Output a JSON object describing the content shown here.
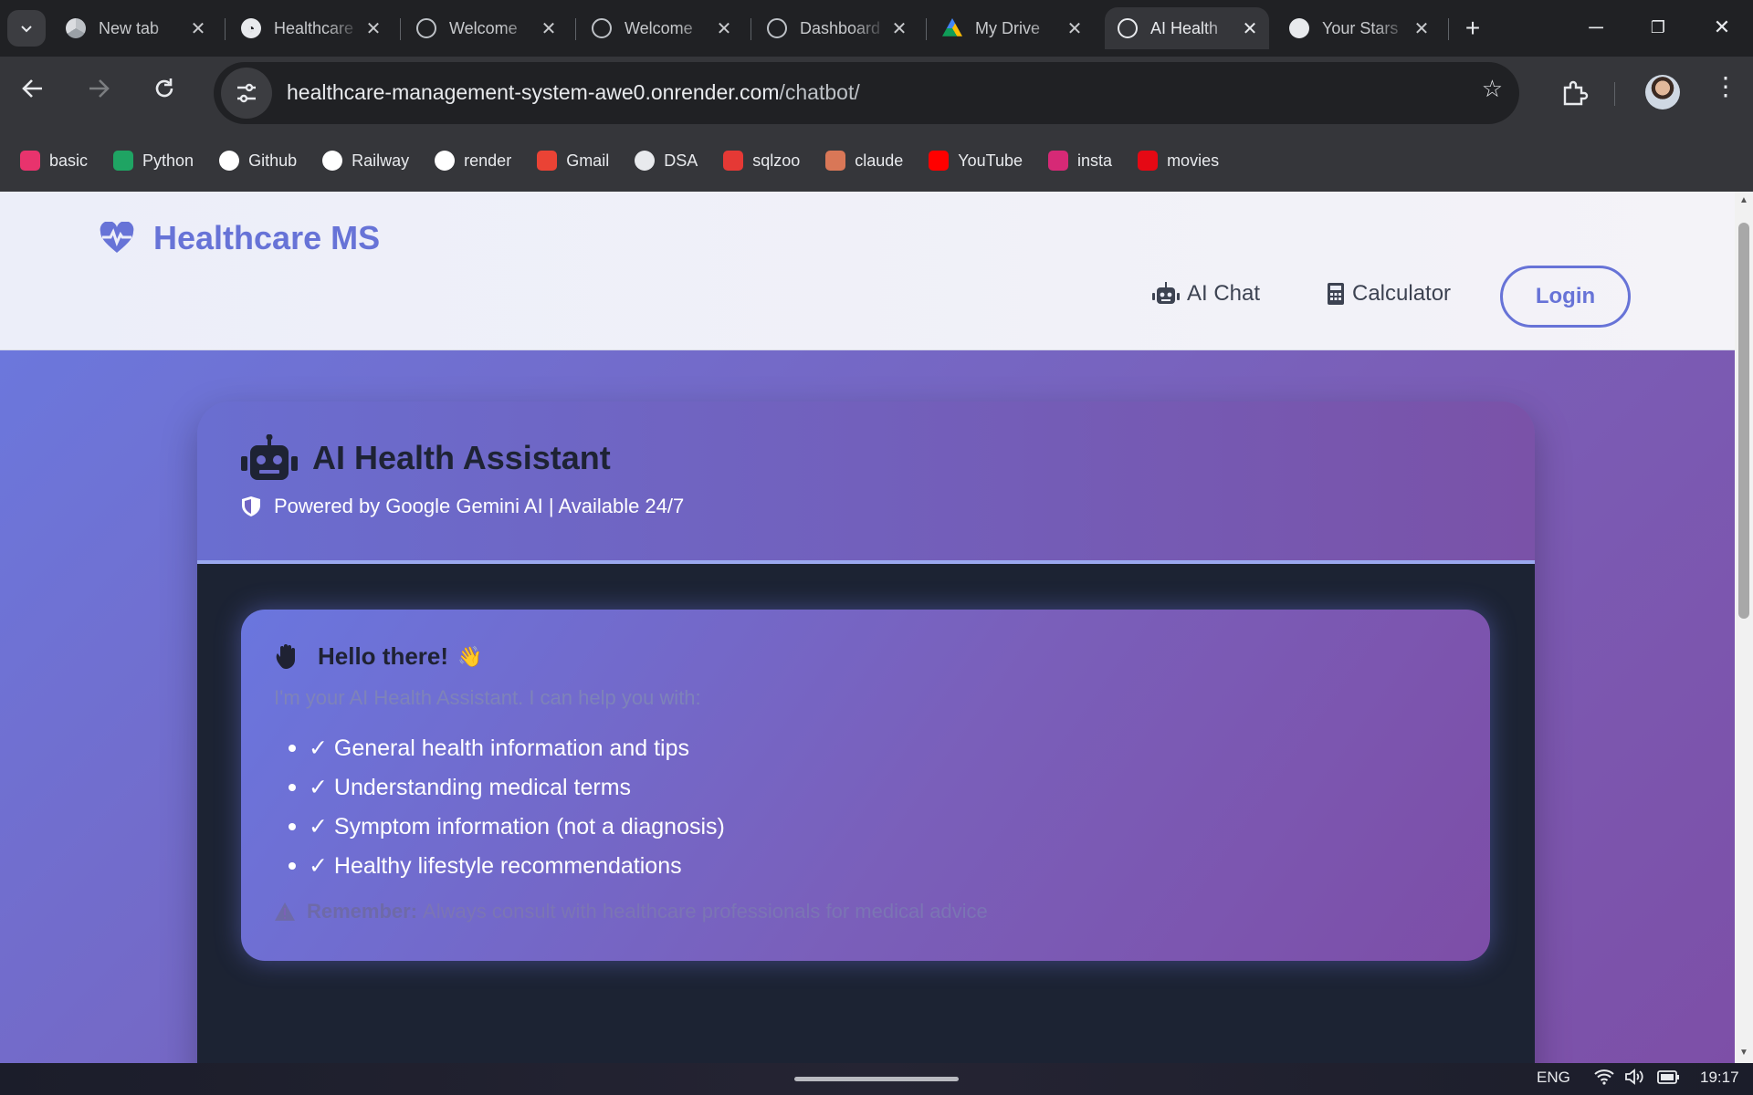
{
  "browser": {
    "tabs": [
      {
        "title": "New tab",
        "icon": "chrome-icon",
        "active": false
      },
      {
        "title": "Healthcare",
        "icon": "render-icon",
        "active": false
      },
      {
        "title": "Welcome",
        "icon": "globe-icon",
        "active": false
      },
      {
        "title": "Welcome",
        "icon": "globe-icon",
        "active": false
      },
      {
        "title": "Dashboard",
        "icon": "globe-icon",
        "active": false
      },
      {
        "title": "My Drive",
        "icon": "google-drive-icon",
        "active": false
      },
      {
        "title": "AI Health",
        "icon": "globe-icon",
        "active": true
      },
      {
        "title": "Your Stars",
        "icon": "github-icon",
        "active": false
      }
    ],
    "url_host": "healthcare-management-system-awe0.onrender.com",
    "url_path": "/chatbot/",
    "bookmarks": [
      {
        "label": "basic",
        "icon": "basic-icon",
        "color": "#e8336d"
      },
      {
        "label": "Python",
        "icon": "python-icon",
        "color": "#1fa463"
      },
      {
        "label": "Github",
        "icon": "github-icon",
        "color": "#ffffff"
      },
      {
        "label": "Railway",
        "icon": "railway-icon",
        "color": "#ffffff"
      },
      {
        "label": "render",
        "icon": "render-icon",
        "color": "#ffffff"
      },
      {
        "label": "Gmail",
        "icon": "gmail-icon",
        "color": "#ea4335"
      },
      {
        "label": "DSA",
        "icon": "rocket-icon",
        "color": "#e8eaed"
      },
      {
        "label": "sqlzoo",
        "icon": "sqlzoo-icon",
        "color": "#e53935"
      },
      {
        "label": "claude",
        "icon": "claude-icon",
        "color": "#d97757"
      },
      {
        "label": "YouTube",
        "icon": "youtube-icon",
        "color": "#ff0000"
      },
      {
        "label": "insta",
        "icon": "instagram-icon",
        "color": "#d62976"
      },
      {
        "label": "movies",
        "icon": "netflix-icon",
        "color": "#e50914"
      }
    ]
  },
  "site": {
    "brand": "Healthcare MS",
    "nav": {
      "ai_chat": "AI Chat",
      "calculator": "Calculator",
      "login": "Login"
    },
    "accent": "#6773d7"
  },
  "chat": {
    "title": "AI Health Assistant",
    "subtitle": "Powered by Google Gemini AI | Available 24/7",
    "greeting": "Hello there!",
    "greeting_emoji": "👋",
    "intro": "I'm your AI Health Assistant. I can help you with:",
    "capabilities": [
      "✓ General health information and tips",
      "✓ Understanding medical terms",
      "✓ Symptom information (not a diagnosis)",
      "✓ Healthy lifestyle recommendations"
    ],
    "remember_label": "Remember:",
    "remember_text": "Always consult with healthcare professionals for medical advice"
  },
  "taskbar": {
    "language": "ENG",
    "time": "19:17"
  }
}
